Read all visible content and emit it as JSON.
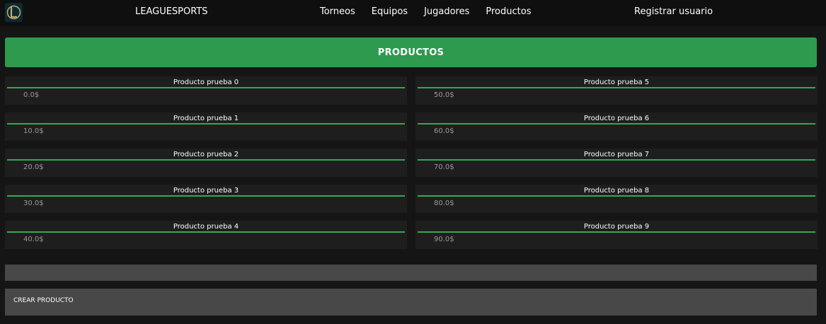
{
  "nav": {
    "brand": "LEAGUESPORTS",
    "links": [
      "Torneos",
      "Equipos",
      "Jugadores",
      "Productos"
    ],
    "register": "Registrar usuario",
    "logo_icon": "league-logo-icon"
  },
  "header": {
    "title": "PRODUCTOS"
  },
  "products": [
    {
      "name": "Producto prueba 0",
      "price": "0.0$"
    },
    {
      "name": "Producto prueba 1",
      "price": "10.0$"
    },
    {
      "name": "Producto prueba 2",
      "price": "20.0$"
    },
    {
      "name": "Producto prueba 3",
      "price": "30.0$"
    },
    {
      "name": "Producto prueba 4",
      "price": "40.0$"
    },
    {
      "name": "Producto prueba 5",
      "price": "50.0$"
    },
    {
      "name": "Producto prueba 6",
      "price": "60.0$"
    },
    {
      "name": "Producto prueba 7",
      "price": "70.0$"
    },
    {
      "name": "Producto prueba 8",
      "price": "80.0$"
    },
    {
      "name": "Producto prueba 9",
      "price": "90.0$"
    }
  ],
  "actions": {
    "create_label": "CREAR PRODUCTO"
  },
  "colors": {
    "accent": "#2e9a4e",
    "line": "#34a853",
    "background": "#151515",
    "card": "#1e1e1e"
  }
}
